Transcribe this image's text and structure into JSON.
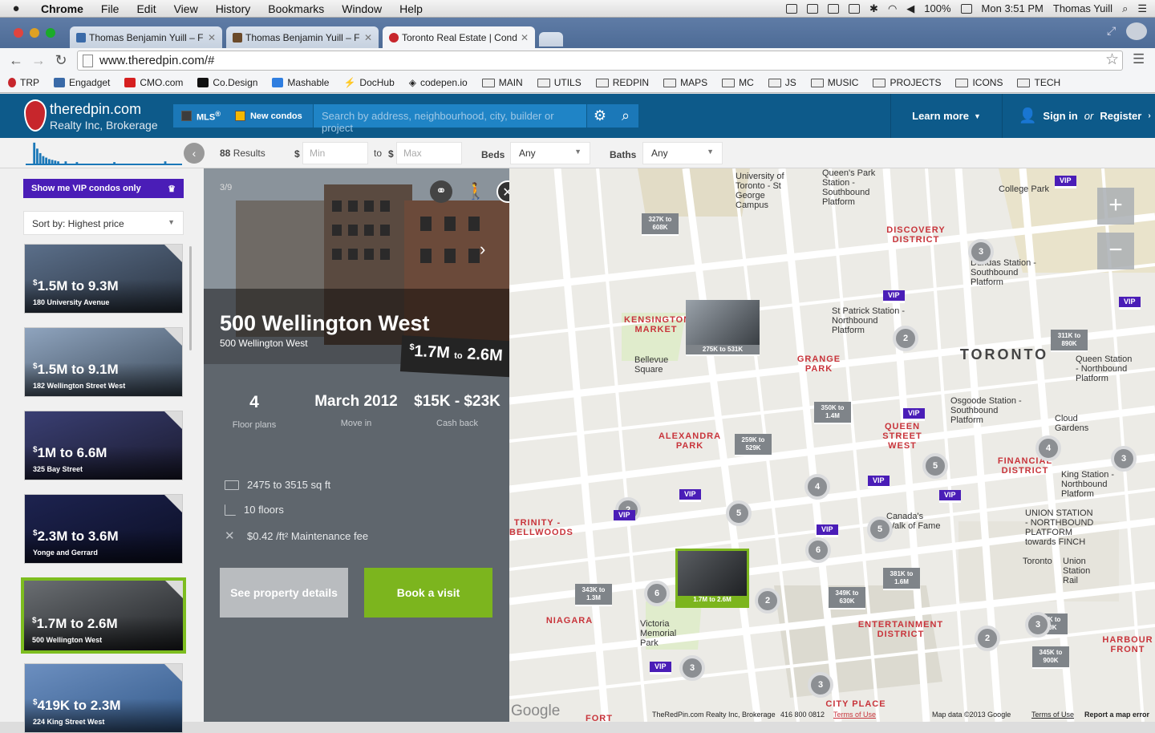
{
  "menubar": {
    "app": "Chrome",
    "items": [
      "File",
      "Edit",
      "View",
      "History",
      "Bookmarks",
      "Window",
      "Help"
    ],
    "battery": "100%",
    "clock": "Mon 3:51 PM",
    "user": "Thomas Yuill"
  },
  "tabs": [
    {
      "title": "Thomas Benjamin Yuill – F",
      "active": false
    },
    {
      "title": "Thomas Benjamin Yuill – F",
      "active": false
    },
    {
      "title": "Toronto Real Estate | Cond",
      "active": true
    }
  ],
  "address": {
    "url": "www.theredpin.com/#"
  },
  "bookmarks": [
    "TRP",
    "Engadget",
    "CMO.com",
    "Co.Design",
    "Mashable",
    "DocHub",
    "codepen.io",
    "MAIN",
    "UTILS",
    "REDPIN",
    "MAPS",
    "MC",
    "JS",
    "MUSIC",
    "PROJECTS",
    "ICONS",
    "TECH"
  ],
  "header": {
    "logo_name": "theredpin.com",
    "logo_sub": "Realty Inc, Brokerage",
    "mls_label": "MLS",
    "mls_sup": "®",
    "condos_label": "New condos",
    "search_placeholder": "Search by address, neighbourhood, city, builder or project",
    "learn_more": "Learn more",
    "sign_in": "Sign in",
    "or": "or",
    "register": "Register"
  },
  "filters": {
    "results_count": "88",
    "results_label": "Results",
    "currency": "$",
    "min_placeholder": "Min",
    "to": "to",
    "max_placeholder": "Max",
    "beds_label": "Beds",
    "beds_value": "Any",
    "baths_label": "Baths",
    "baths_value": "Any"
  },
  "sidebar": {
    "vip_button": "Show me VIP condos only",
    "sort": "Sort by: Highest price",
    "listings": [
      {
        "price": "1.5M to 9.3M",
        "address": "180 University Avenue",
        "color1": "#5b6f8a",
        "color2": "#2a3340"
      },
      {
        "price": "1.5M to 9.1M",
        "address": "182 Wellington Street West",
        "color1": "#8fa4be",
        "color2": "#3c4a5a"
      },
      {
        "price": "1M to 6.6M",
        "address": "325 Bay Street",
        "color1": "#3a3f73",
        "color2": "#1a1a2e"
      },
      {
        "price": "2.3M to 3.6M",
        "address": "Yonge and Gerrard",
        "color1": "#1d2350",
        "color2": "#0c0f25"
      },
      {
        "price": "1.7M to 2.6M",
        "address": "500 Wellington West",
        "color1": "#6a6e72",
        "color2": "#1f2124"
      },
      {
        "price": "419K to 2.3M",
        "address": "224 King Street West",
        "color1": "#6c8fc0",
        "color2": "#345a8a"
      }
    ]
  },
  "detail": {
    "counter": "3/9",
    "title": "500 Wellington West",
    "address": "500 Wellington West",
    "price_from": "1.7M",
    "price_to_word": "to",
    "price_to": "2.6M",
    "currency": "$",
    "stats": [
      {
        "value": "4",
        "label": "Floor plans"
      },
      {
        "value": "March 2012",
        "label": "Move in"
      },
      {
        "value": "$15K - $23K",
        "label": "Cash back"
      }
    ],
    "features": [
      "2475 to 3515 sq ft",
      "10 floors",
      "$0.42 /ft² Maintenance fee"
    ],
    "see_details": "See property details",
    "book_visit": "Book a visit"
  },
  "map": {
    "districts": [
      "DISCOVERY DISTRICT",
      "KENSINGTON MARKET",
      "GRANGE PARK",
      "TORONTO",
      "ALEXANDRA PARK",
      "QUEEN STREET WEST",
      "FINANCIAL DISTRICT",
      "NIAGARA",
      "ENTERTAINMENT DISTRICT",
      "HARBOUR FRONT",
      "TRINITY - BELLWOODS",
      "CITY PLACE",
      "FORT"
    ],
    "places": [
      "University of Toronto - St George Campus",
      "Queen's Park Station - Southbound Platform",
      "College Park",
      "Dundas Station - Southbound Platform",
      "St Patrick Station - Northbound Platform",
      "Queen Station - Northbound Platform",
      "Osgoode Station - Southbound Platform",
      "Cloud Gardens",
      "King Station - Northbound Platform",
      "UNION STATION - NORTHBOUND PLATFORM towards FINCH",
      "Union Station Rail",
      "Bellevue Square",
      "Canada's Walk of Fame",
      "Victoria Memorial Park",
      "Toronto"
    ],
    "price_pins": [
      "327K to 608K",
      "350K to 1.4M",
      "259K to 529K",
      "311K to 890K",
      "343K to 1.3M",
      "349K to 630K",
      "381K to 1.6M",
      "375K to 560K",
      "345K to 900K"
    ],
    "photo_pins": [
      {
        "label": "275K to 531K"
      },
      {
        "label": "1.7M to 2.6M"
      }
    ],
    "clusters": [
      "3",
      "2",
      "4",
      "3",
      "5",
      "4",
      "2",
      "5",
      "6",
      "5",
      "6",
      "2",
      "3",
      "2",
      "3",
      "3",
      "5"
    ],
    "vip_label": "VIP",
    "zoom_in": "+",
    "zoom_out": "−",
    "footer": {
      "google": "Google",
      "company": "TheRedPin.com Realty Inc, Brokerage",
      "phone": "416 800 0812",
      "terms": "Terms of Use",
      "mapdata": "Map data ©2013 Google",
      "terms2": "Terms of Use",
      "report": "Report a map error"
    }
  }
}
